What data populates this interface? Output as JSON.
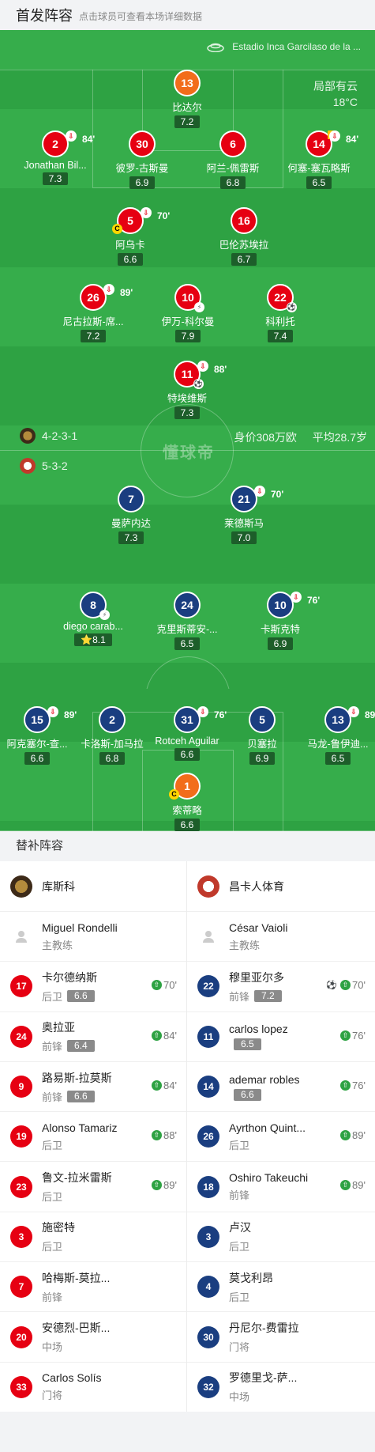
{
  "header": {
    "title": "首发阵容",
    "hint": "点击球员可查看本场详细数据"
  },
  "venue": "Estadio Inca Garcilaso de la ...",
  "weather": {
    "condition": "局部有云",
    "temp": "18°C"
  },
  "watermark": "懂球帝",
  "home": {
    "formation": "4-2-3-1",
    "value": "身价308万欧",
    "avg_age": "平均28.7岁",
    "players": [
      {
        "num": "13",
        "name": "比达尔",
        "rating": "7.2",
        "color": "orange"
      },
      {
        "num": "2",
        "name": "Jonathan Bil...",
        "rating": "7.3",
        "color": "red",
        "subtime": "84'"
      },
      {
        "num": "30",
        "name": "彼罗-古斯曼",
        "rating": "6.9",
        "color": "red"
      },
      {
        "num": "6",
        "name": "阿兰-佩雷斯",
        "rating": "6.8",
        "color": "red"
      },
      {
        "num": "14",
        "name": "何塞-塞瓦略斯",
        "rating": "6.5",
        "color": "red",
        "subtime": "84'"
      },
      {
        "num": "5",
        "name": "阿乌卡",
        "rating": "6.6",
        "color": "red",
        "subtime": "70'"
      },
      {
        "num": "16",
        "name": "巴伦苏埃拉",
        "rating": "6.7",
        "color": "red"
      },
      {
        "num": "26",
        "name": "尼古拉斯-席...",
        "rating": "7.2",
        "color": "red",
        "subtime": "89'"
      },
      {
        "num": "10",
        "name": "伊万-科尔曼",
        "rating": "7.9",
        "color": "red"
      },
      {
        "num": "22",
        "name": "科利托",
        "rating": "7.4",
        "color": "red"
      },
      {
        "num": "11",
        "name": "特埃维斯",
        "rating": "7.3",
        "color": "red",
        "subtime": "88'"
      }
    ]
  },
  "away": {
    "formation": "5-3-2",
    "players": [
      {
        "num": "7",
        "name": "曼萨内达",
        "rating": "7.3",
        "color": "blue"
      },
      {
        "num": "21",
        "name": "莱德斯马",
        "rating": "7.0",
        "color": "blue",
        "subtime": "70'"
      },
      {
        "num": "8",
        "name": "diego carab...",
        "rating": "8.1",
        "color": "blue"
      },
      {
        "num": "24",
        "name": "克里斯蒂安-...",
        "rating": "6.5",
        "color": "blue"
      },
      {
        "num": "10",
        "name": "卡斯克特",
        "rating": "6.9",
        "color": "blue",
        "subtime": "76'"
      },
      {
        "num": "15",
        "name": "阿克塞尔-查...",
        "rating": "6.6",
        "color": "blue",
        "subtime": "89'"
      },
      {
        "num": "2",
        "name": "卡洛斯-加马拉",
        "rating": "6.8",
        "color": "blue"
      },
      {
        "num": "31",
        "name": "Rotceh Aguilar",
        "rating": "6.6",
        "color": "blue",
        "subtime": "76'"
      },
      {
        "num": "5",
        "name": "贝塞拉",
        "rating": "6.9",
        "color": "blue"
      },
      {
        "num": "13",
        "name": "马龙-鲁伊迪...",
        "rating": "6.5",
        "color": "blue",
        "subtime": "89'"
      },
      {
        "num": "1",
        "name": "索蒂略",
        "rating": "6.6",
        "color": "orange"
      }
    ]
  },
  "subs": {
    "title": "替补阵容",
    "home_team": "库斯科",
    "away_team": "昌卡人体育",
    "home_coach": {
      "name": "Miguel Rondelli",
      "role": "主教练"
    },
    "away_coach": {
      "name": "César Vaioli",
      "role": "主教练"
    },
    "home": [
      {
        "num": "17",
        "name": "卡尔德纳斯",
        "pos": "后卫",
        "rating": "6.6",
        "time": "70'"
      },
      {
        "num": "24",
        "name": "奥拉亚",
        "pos": "前锋",
        "rating": "6.4",
        "time": "84'"
      },
      {
        "num": "9",
        "name": "路易斯-拉莫斯",
        "pos": "前锋",
        "rating": "6.6",
        "time": "84'"
      },
      {
        "num": "19",
        "name": "Alonso Tamariz",
        "pos": "后卫",
        "rating": "",
        "time": "88'"
      },
      {
        "num": "23",
        "name": "鲁文-拉米雷斯",
        "pos": "后卫",
        "rating": "",
        "time": "89'"
      },
      {
        "num": "3",
        "name": "施密特",
        "pos": "后卫",
        "rating": "",
        "time": ""
      },
      {
        "num": "7",
        "name": "哈梅斯-莫拉...",
        "pos": "前锋",
        "rating": "",
        "time": ""
      },
      {
        "num": "20",
        "name": "安德烈-巴斯...",
        "pos": "中场",
        "rating": "",
        "time": ""
      },
      {
        "num": "33",
        "name": "Carlos Solís",
        "pos": "门将",
        "rating": "",
        "time": ""
      }
    ],
    "away": [
      {
        "num": "22",
        "name": "穆里亚尔多",
        "pos": "前锋",
        "rating": "7.2",
        "time": "70'",
        "goal": true
      },
      {
        "num": "11",
        "name": "carlos lopez",
        "pos": "",
        "rating": "6.5",
        "time": "76'"
      },
      {
        "num": "14",
        "name": "ademar robles",
        "pos": "",
        "rating": "6.6",
        "time": "76'"
      },
      {
        "num": "26",
        "name": "Ayrthon Quint...",
        "pos": "后卫",
        "rating": "",
        "time": "89'"
      },
      {
        "num": "18",
        "name": "Oshiro Takeuchi",
        "pos": "前锋",
        "rating": "",
        "time": "89'"
      },
      {
        "num": "3",
        "name": "卢汉",
        "pos": "后卫",
        "rating": "",
        "time": ""
      },
      {
        "num": "4",
        "name": "莫戈利昂",
        "pos": "后卫",
        "rating": "",
        "time": ""
      },
      {
        "num": "30",
        "name": "丹尼尔-费雷拉",
        "pos": "门将",
        "rating": "",
        "time": ""
      },
      {
        "num": "32",
        "name": "罗德里戈-萨...",
        "pos": "中场",
        "rating": "",
        "time": ""
      }
    ]
  },
  "colors": {
    "pitch": "#2ea243",
    "home_jersey": "#e60012",
    "away_jersey": "#1a3e80",
    "keeper": "#f26d1b"
  }
}
